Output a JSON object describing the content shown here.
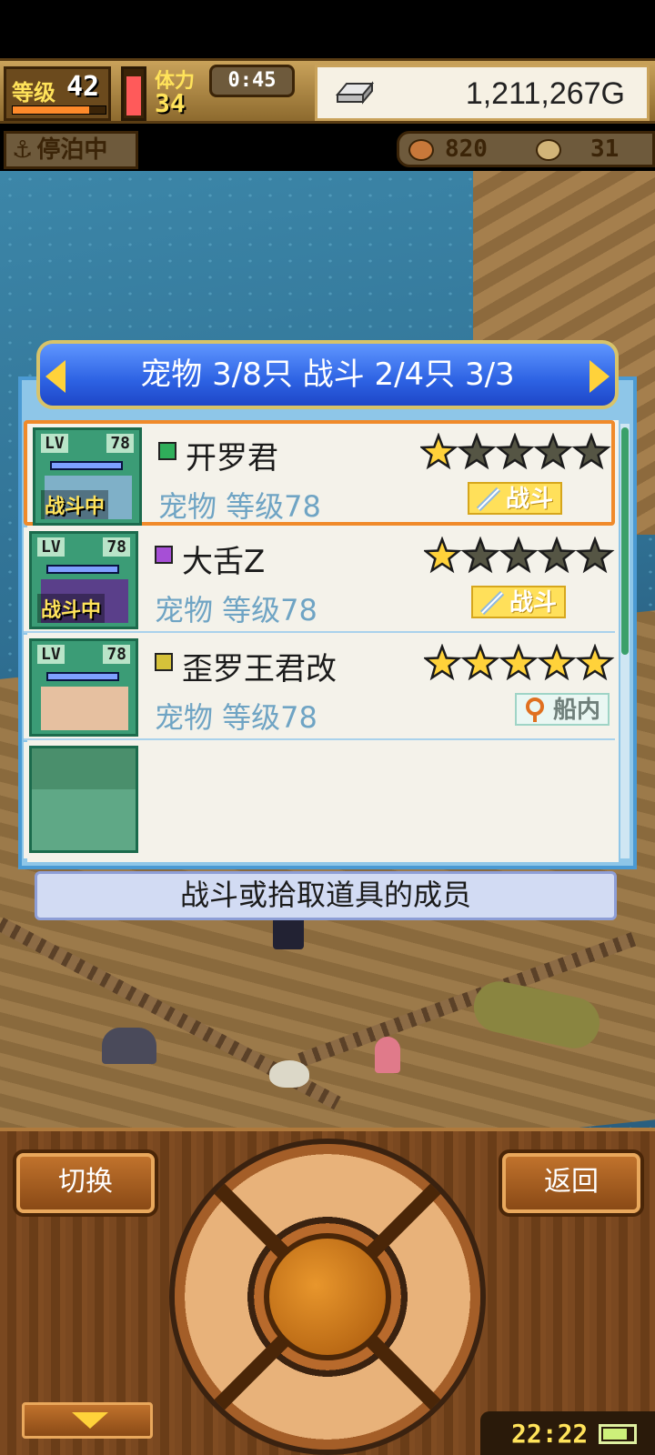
{
  "hud": {
    "level_label": "等级",
    "level_value": "42",
    "level_progress": 0.82,
    "stamina_label": "体力",
    "stamina_value": "34",
    "stamina_fraction": 0.9,
    "timer": "0:45",
    "gold": "1,211,267G",
    "gold_icon": "silver-bar-icon"
  },
  "status": {
    "dock_label": "停泊中",
    "dock_icon": "anchor-icon",
    "resource_1_icon": "coin-bag-icon",
    "resource_1_value": "820",
    "resource_2_icon": "medal-icon",
    "resource_2_value": "31"
  },
  "panel": {
    "header": "宠物 3/8只 战斗 2/4只  3/3",
    "footer": "战斗或拾取道具的成员",
    "pets": [
      {
        "name": "开罗君",
        "sub": "宠物 等级78",
        "lv_label": "LV",
        "lv_value": "78",
        "stars_filled": 1,
        "stars_total": 5,
        "in_battle_badge": "战斗中",
        "status": "战斗",
        "element_color": "#2fae5a",
        "selected": true
      },
      {
        "name": "大舌Z",
        "sub": "宠物 等级78",
        "lv_label": "LV",
        "lv_value": "78",
        "stars_filled": 1,
        "stars_total": 5,
        "in_battle_badge": "战斗中",
        "status": "战斗",
        "element_color": "#a64fd6",
        "selected": false
      },
      {
        "name": "歪罗王君改",
        "sub": "宠物 等级78",
        "lv_label": "LV",
        "lv_value": "78",
        "stars_filled": 5,
        "stars_total": 5,
        "in_battle_badge": "",
        "status": "船内",
        "element_color": "#d6c23a",
        "selected": false
      }
    ]
  },
  "controls": {
    "switch_label": "切换",
    "back_label": "返回",
    "clock": "22:22",
    "battery_level": 0.8
  },
  "colors": {
    "accent_blue": "#2d62e3",
    "selection_orange": "#f08a2a",
    "star_gold": "#ffd23a",
    "star_empty": "#555544"
  }
}
